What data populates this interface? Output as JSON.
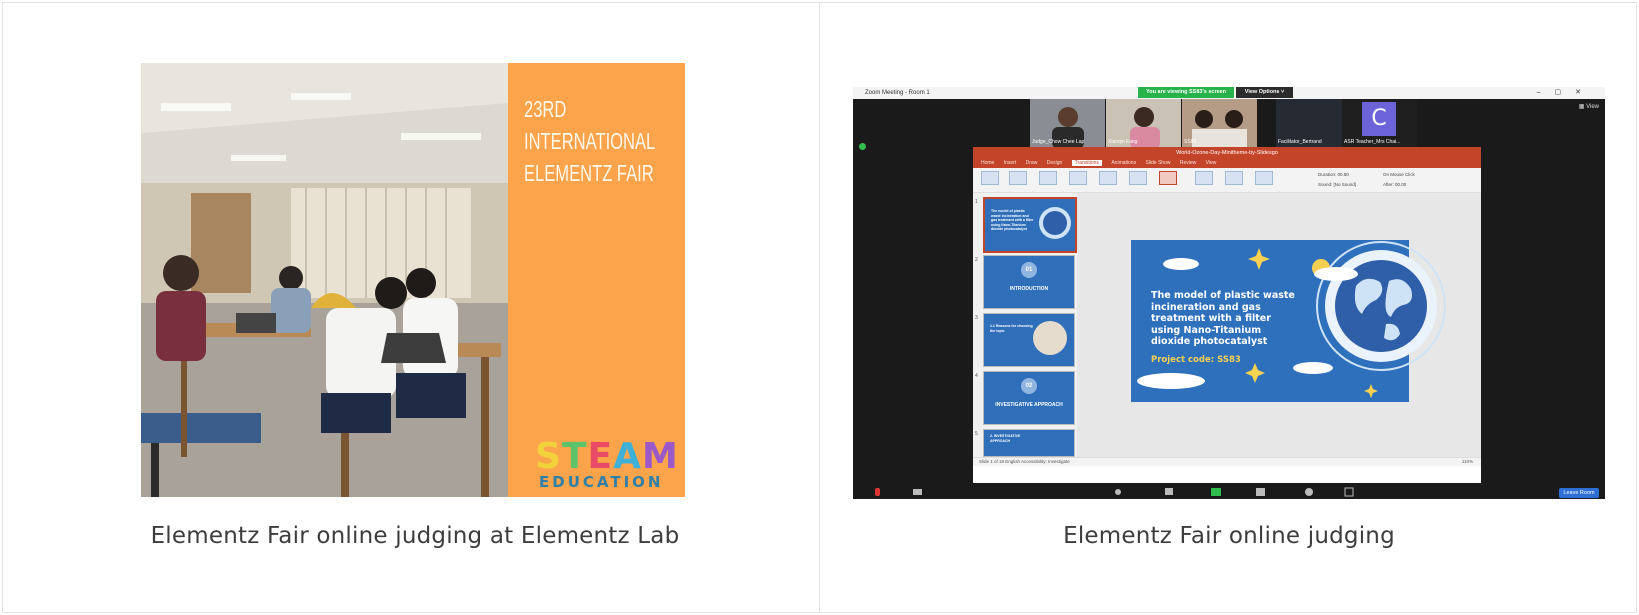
{
  "cards": [
    {
      "caption": "Elementz Fair online judging at Elementz Lab",
      "poster": {
        "title_lines": [
          "23RD",
          "INTERNATIONAL",
          "ELEMENTZ FAIR"
        ],
        "logo_word": "STEAM",
        "logo_sub": "EDUCATION"
      }
    },
    {
      "caption": "Elementz Fair online judging",
      "zoom": {
        "window_title": "Zoom Meeting - Room 1",
        "viewing_banner": "You are viewing SS83's screen",
        "view_options": "View Options ˅",
        "view_button": "View",
        "participants": [
          "Judge_Chow Chee Lap",
          "Xiaoqin Fang",
          "SS83",
          "Facilitator_Bertrand",
          "ASR Teacher_Mrs Chai..."
        ],
        "avatar_letter": "C",
        "leave_button": "Leave Room",
        "powerpoint": {
          "doc_title": "World-Ozone-Day-Minitheme-by-Slidesgo",
          "tabs": [
            "Home",
            "Insert",
            "Draw",
            "Design",
            "Transitions",
            "Animations",
            "Slide Show",
            "Review",
            "View"
          ],
          "active_tab": "Transitions",
          "duration_label": "Duration: 00.50",
          "sound_label": "Sound: [No Sound]",
          "on_mouse_click": "On Mouse Click",
          "after_label": "After: 00.00",
          "thumbnails": [
            {
              "index": "1",
              "text": "The model of plastic waste incineration and gas treatment with a filter using Nano-Titanium dioxide photocatalyst"
            },
            {
              "index": "2",
              "number": "01",
              "text": "INTRODUCTION"
            },
            {
              "index": "3",
              "text": "1.1 Reasons for choosing the topic"
            },
            {
              "index": "4",
              "number": "02",
              "text": "INVESTIGATIVE APPROACH"
            },
            {
              "index": "5",
              "text": "2. INVESTIGATIVE APPROACH"
            }
          ],
          "slide": {
            "title": "The model of plastic waste incineration and gas treatment with a filter using Nano-Titanium dioxide photocatalyst",
            "project_code": "Project code: SS83"
          },
          "status": "Slide 1 of 18    English    Accessibility: Investigate",
          "zoom_level": "110%"
        }
      }
    }
  ]
}
